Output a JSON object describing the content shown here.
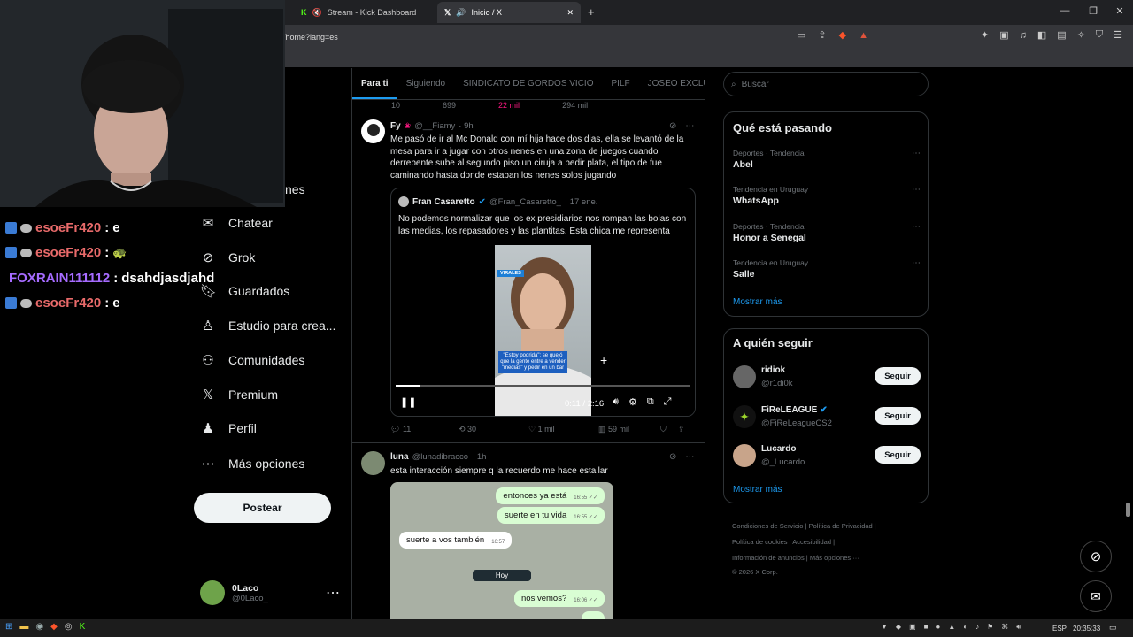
{
  "browser": {
    "tabs": [
      {
        "label": "Stream - Kick Dashboard"
      },
      {
        "label": "Inicio / X"
      }
    ],
    "url": "/home?lang=es",
    "new_tab": "+"
  },
  "chat": [
    {
      "user": "esoeFr420",
      "sep": " : ",
      "msg": "e",
      "color": "#e86a6a"
    },
    {
      "user": "esoeFr420",
      "sep": " : ",
      "msg": "",
      "color": "#e86a6a"
    },
    {
      "user": "FOXRAIN111112",
      "sep": " : ",
      "msg": "dsahdjasdjahd",
      "color": "#a66bff"
    },
    {
      "user": "esoeFr420",
      "sep": " : ",
      "msg": "e",
      "color": "#e86a6a"
    }
  ],
  "sidebar": {
    "partial_label": "nes",
    "items": [
      {
        "label": "Chatear",
        "icon": "chat-icon"
      },
      {
        "label": "Grok",
        "icon": "grok-icon"
      },
      {
        "label": "Guardados",
        "icon": "bookmark-icon"
      },
      {
        "label": "Estudio para crea...",
        "icon": "studio-icon"
      },
      {
        "label": "Comunidades",
        "icon": "communities-icon"
      },
      {
        "label": "Premium",
        "icon": "x-logo-icon"
      },
      {
        "label": "Perfil",
        "icon": "profile-icon"
      },
      {
        "label": "Más opciones",
        "icon": "more-icon"
      }
    ],
    "post_button": "Postear",
    "account": {
      "name": "0Laco",
      "handle": "@0Laco_"
    }
  },
  "timeline": {
    "tabs": [
      "Para ti",
      "Siguiendo",
      "SINDICATO DE GORDOS VICIO",
      "PILF",
      "JOSEO EXCLUSI"
    ],
    "top_stats": {
      "replies": "10",
      "reposts": "699",
      "likes": "22 mil",
      "views": "294 mil"
    },
    "tweet1": {
      "name": "Fy",
      "handle": "@__Fiamy",
      "time": "· 9h",
      "text": "Me pasó de ir al Mc Donald con mí hija hace dos dias, ella se levantó de la mesa para ir a jugar con otros nenes en una zona de juegos cuando derrepente sube al segundo piso un ciruja a pedir plata, el tipo de fue caminando hasta donde estaban los nenes solos jugando",
      "quote": {
        "name": "Fran Casaretto",
        "handle": "@Fran_Casaretto_",
        "time": "· 17 ene.",
        "text": "No podemos normalizar que los ex presidiarios nos rompan las bolas con las medias, los repasadores y las plantitas. Esta chica me representa",
        "video_tag": "VIRALES",
        "video_caption": "\"Estoy podrida\": se quejó que la gente entre a vender \"medias\" y pedir en un bar",
        "time_display": "0:11 / 2:16",
        "progress": 0.08
      },
      "stats": {
        "replies": "11",
        "reposts": "30",
        "likes": "1 mil",
        "views": "59 mil"
      }
    },
    "tweet2": {
      "name": "luna",
      "handle": "@lunadibracco",
      "time": "· 1h",
      "text": "esta interacción siempre q la recuerdo me hace estallar",
      "messages": [
        {
          "text": "entonces ya está",
          "time": "16:55 ✓✓",
          "dir": "out"
        },
        {
          "text": "suerte en tu vida",
          "time": "16:55 ✓✓",
          "dir": "out"
        },
        {
          "text": "suerte a vos también",
          "time": "16:57",
          "dir": "in"
        },
        {
          "text": "Hoy",
          "time": "",
          "dir": "day"
        },
        {
          "text": "nos vemos?",
          "time": "16:06 ✓✓",
          "dir": "out"
        }
      ]
    }
  },
  "right": {
    "search_placeholder": "Buscar",
    "trends_title": "Qué está pasando",
    "trends": [
      {
        "meta": "Deportes · Tendencia",
        "name": "Abel"
      },
      {
        "meta": "Tendencia en Uruguay",
        "name": "WhatsApp"
      },
      {
        "meta": "Deportes · Tendencia",
        "name": "Honor a Senegal"
      },
      {
        "meta": "Tendencia en Uruguay",
        "name": "Salle"
      }
    ],
    "show_more": "Mostrar más",
    "follow_title": "A quién seguir",
    "follow": [
      {
        "name": "ridiok",
        "handle": "@r1di0k",
        "button": "Seguir"
      },
      {
        "name": "FiReLEAGUE",
        "handle": "@FiReLeagueCS2",
        "button": "Seguir"
      },
      {
        "name": "Lucardo",
        "handle": "@_Lucardo",
        "button": "Seguir"
      }
    ],
    "show_more2": "Mostrar más",
    "footer": {
      "l1": "Condiciones de Servicio",
      "l2": "Política de Privacidad",
      "l3": "Política de cookies",
      "l4": "Accesibilidad",
      "l5": "Información de anuncios",
      "l6": "Más opciones ···",
      "copy": "© 2026 X Corp."
    }
  },
  "taskbar": {
    "lang": "ESP",
    "clock": "20:35:33"
  }
}
